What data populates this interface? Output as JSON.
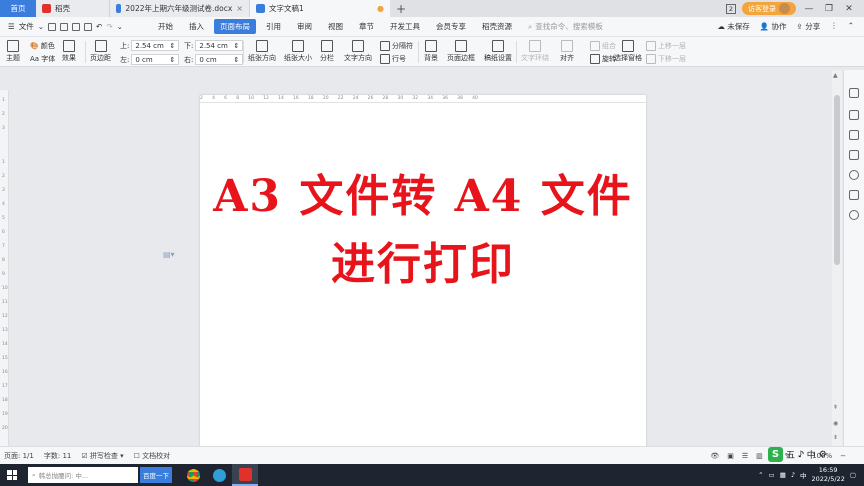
{
  "tabs": {
    "home": "首页",
    "docer": "稻壳",
    "doc1": "2022年上期六年级测试卷.docx",
    "doc2": "文字文稿1",
    "add": "+",
    "login": "访客登录",
    "badge": "2"
  },
  "menu": {
    "file": "文件",
    "items": [
      "开始",
      "插入",
      "页面布局",
      "引用",
      "审阅",
      "视图",
      "章节",
      "开发工具",
      "会员专享",
      "稻壳资源"
    ],
    "search": "查找命令、搜索模板",
    "unsaved": "未保存",
    "collab": "协作",
    "share": "分享"
  },
  "toolbar": {
    "theme": "主题",
    "colors": "颜色",
    "fonts": "Aa 字体",
    "effects": "效果",
    "margins": "页边距",
    "top_label": "上:",
    "top_value": "2.54 cm",
    "bottom_label": "下:",
    "bottom_value": "2.54 cm",
    "left_label": "左:",
    "left_value": "0 cm",
    "right_label": "右:",
    "right_value": "0 cm",
    "orientation": "纸张方向",
    "size": "纸张大小",
    "columns": "分栏",
    "text_direction": "文字方向",
    "breaks": "分隔符",
    "line_numbers": "行号",
    "background": "背景",
    "page_border": "页面边框",
    "manuscript": "稿纸设置",
    "wrap": "文字环绕",
    "align": "对齐",
    "rotate": "旋转",
    "group": "组合",
    "selection_pane": "选择窗格",
    "bring_forward": "上移一层",
    "send_backward": "下移一层"
  },
  "document": {
    "line1": "A3 文件转 A4 文件",
    "line2": "进行打印"
  },
  "status": {
    "page": "页面: 1/1",
    "words": "字数: 11",
    "spell": "拼写检查",
    "proof": "文档校对",
    "zoom": "100%"
  },
  "ime": {
    "logo": "S",
    "chars": [
      "五",
      "♪",
      "中"
    ]
  },
  "taskbar": {
    "search_placeholder": "韩总抛腰问: 中...",
    "search_btn": "百度一下",
    "time": "16:59",
    "date": "2022/5/22"
  },
  "colors": {
    "accent": "#3b7ddd",
    "doc_text": "#e8141b",
    "taskbar": "#1e2530"
  }
}
